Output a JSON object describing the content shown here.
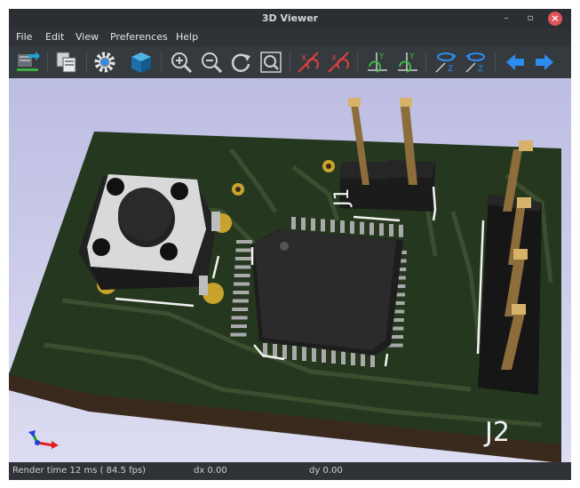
{
  "window": {
    "title": "3D Viewer",
    "minimize": "–",
    "maximize": "▫",
    "close": "×"
  },
  "menu": [
    "File",
    "Edit",
    "View",
    "Preferences",
    "Help"
  ],
  "toolbar": [
    "reload-board-icon",
    "copy-image-icon",
    "render-options-icon",
    "3d-cube-icon",
    "zoom-in-icon",
    "zoom-out-icon",
    "redraw-icon",
    "zoom-fit-icon",
    "rotate-x-ccw-icon",
    "rotate-x-cw-icon",
    "rotate-y-ccw-icon",
    "rotate-y-cw-icon",
    "rotate-z-ccw-icon",
    "rotate-z-cw-icon",
    "arrow-left-icon",
    "arrow-right-icon"
  ],
  "board": {
    "labels": {
      "j1": "J1",
      "j2": "J2"
    }
  },
  "colors": {
    "board": "#2a3b23",
    "trace": "#3b4e30",
    "pad": "#c8a32c",
    "silkscreen": "#f2f2f2",
    "toolbar_blue": "#2d8cf0"
  },
  "status": {
    "render_time": "Render time 12 ms ( 84.5 fps)",
    "dx": "dx 0.00",
    "dy": "dy 0.00"
  }
}
